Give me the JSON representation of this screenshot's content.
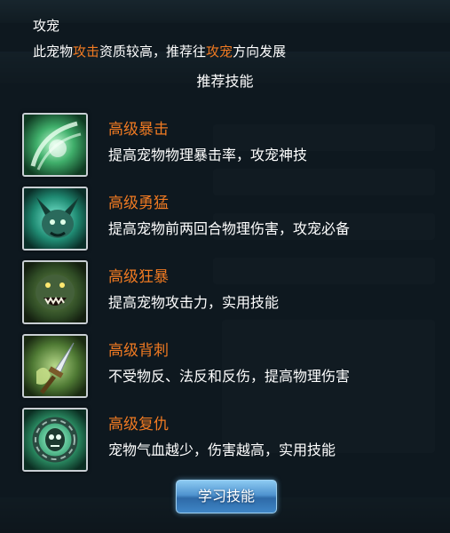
{
  "panel": {
    "title": "攻宠",
    "description": {
      "part1": "此宠物",
      "highlight1": "攻击",
      "part2": "资质较高，推荐往",
      "highlight2": "攻宠",
      "part3": "方向发展"
    },
    "section_title": "推荐技能",
    "skills": [
      {
        "name": "高级暴击",
        "desc": "提高宠物物理暴击率，攻宠神技",
        "icon": "claw-slash-icon"
      },
      {
        "name": "高级勇猛",
        "desc": "提高宠物前两回合物理伤害，攻宠必备",
        "icon": "horned-beast-icon"
      },
      {
        "name": "高级狂暴",
        "desc": "提高宠物攻击力，实用技能",
        "icon": "roaring-beast-icon"
      },
      {
        "name": "高级背刺",
        "desc": "不受物反、法反和反伤，提高物理伤害",
        "icon": "dagger-icon"
      },
      {
        "name": "高级复仇",
        "desc": "宠物气血越少，伤害越高，实用技能",
        "icon": "vengeful-spirit-icon"
      }
    ],
    "learn_button": "学习技能"
  },
  "colors": {
    "highlight": "#f07a22",
    "text": "#ffffff",
    "button": "#4f93cf"
  }
}
